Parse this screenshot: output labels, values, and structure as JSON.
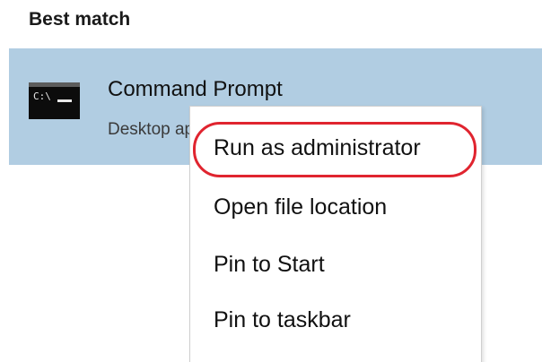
{
  "section": {
    "title": "Best match"
  },
  "best_match": {
    "app_name": "Command Prompt",
    "app_type": "Desktop app",
    "icon": "command-prompt-icon",
    "icon_prompt_text": "C:\\"
  },
  "context_menu": {
    "items": [
      {
        "label": "Run as administrator",
        "highlighted": true
      },
      {
        "label": "Open file location",
        "highlighted": false
      },
      {
        "label": "Pin to Start",
        "highlighted": false
      },
      {
        "label": "Pin to taskbar",
        "highlighted": false
      }
    ]
  },
  "colors": {
    "selection_bg": "#b1cde2",
    "highlight_ring": "#e0242f",
    "menu_bg": "#ffffff"
  }
}
